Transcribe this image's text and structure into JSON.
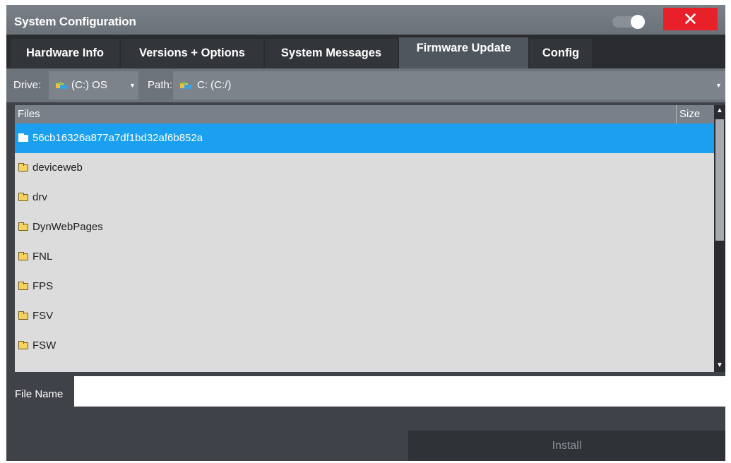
{
  "window": {
    "title": "System Configuration",
    "close_label": "✕"
  },
  "tabs": [
    {
      "label": "Hardware Info",
      "active": false
    },
    {
      "label": "Versions + Options",
      "active": false
    },
    {
      "label": "System Messages",
      "active": false
    },
    {
      "label": "Firmware Update",
      "active": true
    },
    {
      "label": "Config",
      "active": false
    }
  ],
  "drive_bar": {
    "drive_label": "Drive:",
    "drive_value": "(C:) OS",
    "path_label": "Path:",
    "path_value": "C: (C:/)"
  },
  "file_list": {
    "col_files": "Files",
    "col_size": "Size",
    "rows": [
      {
        "name": "56cb16326a877a7df1bd32af6b852a",
        "selected": true
      },
      {
        "name": "deviceweb",
        "selected": false
      },
      {
        "name": "drv",
        "selected": false
      },
      {
        "name": "DynWebPages",
        "selected": false
      },
      {
        "name": "FNL",
        "selected": false
      },
      {
        "name": "FPS",
        "selected": false
      },
      {
        "name": "FSV",
        "selected": false
      },
      {
        "name": "FSW",
        "selected": false
      }
    ]
  },
  "file_name": {
    "label": "File Name",
    "value": ""
  },
  "install_label": "Install",
  "colors": {
    "selection": "#1aa0ee",
    "close": "#e8202a",
    "background": "#3f4248"
  }
}
